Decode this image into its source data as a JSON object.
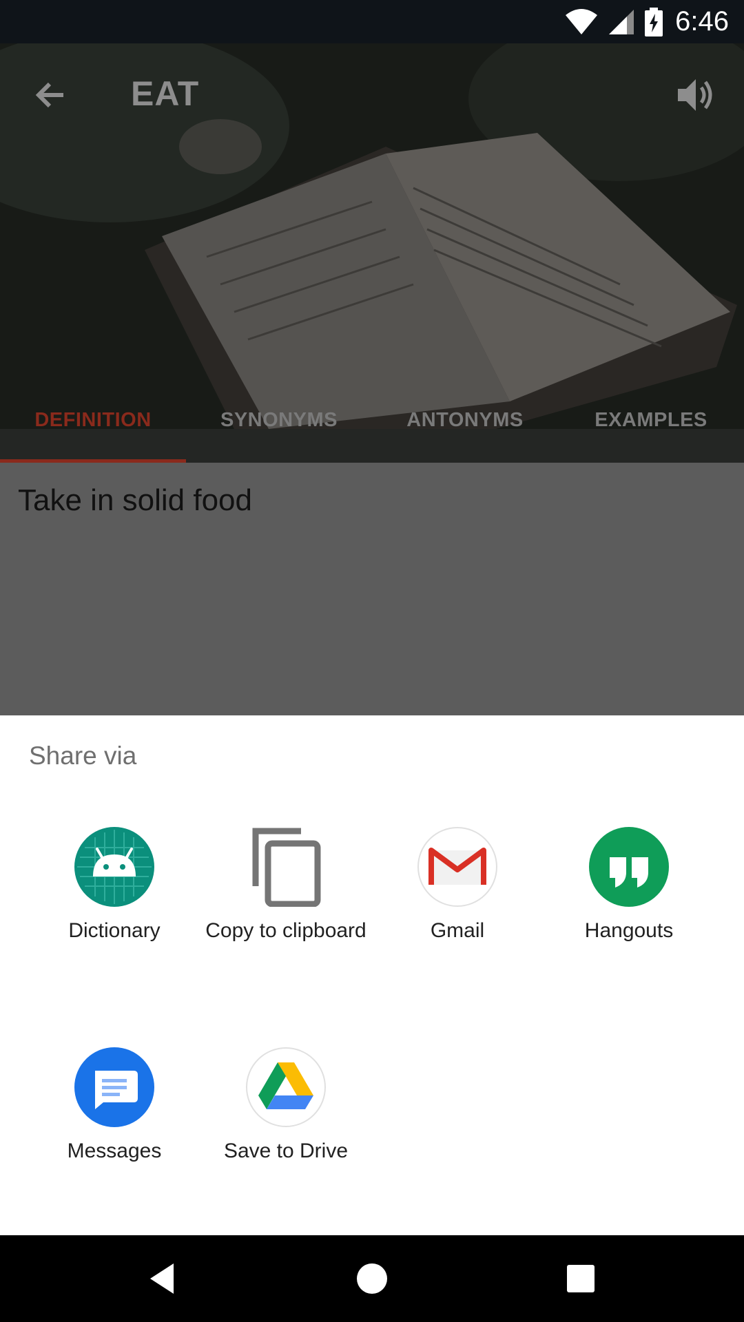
{
  "status_bar": {
    "time": "6:46",
    "icons": [
      "wifi-icon",
      "cell-signal-icon",
      "battery-charging-icon"
    ]
  },
  "app": {
    "title": "EAT",
    "tabs": [
      {
        "label": "DEFINITION",
        "active": true
      },
      {
        "label": "SYNONYMS",
        "active": false
      },
      {
        "label": "ANTONYMS",
        "active": false
      },
      {
        "label": "EXAMPLES",
        "active": false
      }
    ],
    "definition": "Take in solid food",
    "accent_color": "#c0392b"
  },
  "share_sheet": {
    "title": "Share via",
    "targets": [
      {
        "label": "Dictionary",
        "icon": "android-app-icon"
      },
      {
        "label": "Copy to clipboard",
        "icon": "copy-icon"
      },
      {
        "label": "Gmail",
        "icon": "gmail-icon"
      },
      {
        "label": "Hangouts",
        "icon": "hangouts-icon"
      },
      {
        "label": "Messages",
        "icon": "messages-icon"
      },
      {
        "label": "Save to Drive",
        "icon": "drive-icon"
      }
    ]
  },
  "nav_bar": {
    "buttons": [
      "back-icon",
      "home-icon",
      "recents-icon"
    ]
  }
}
